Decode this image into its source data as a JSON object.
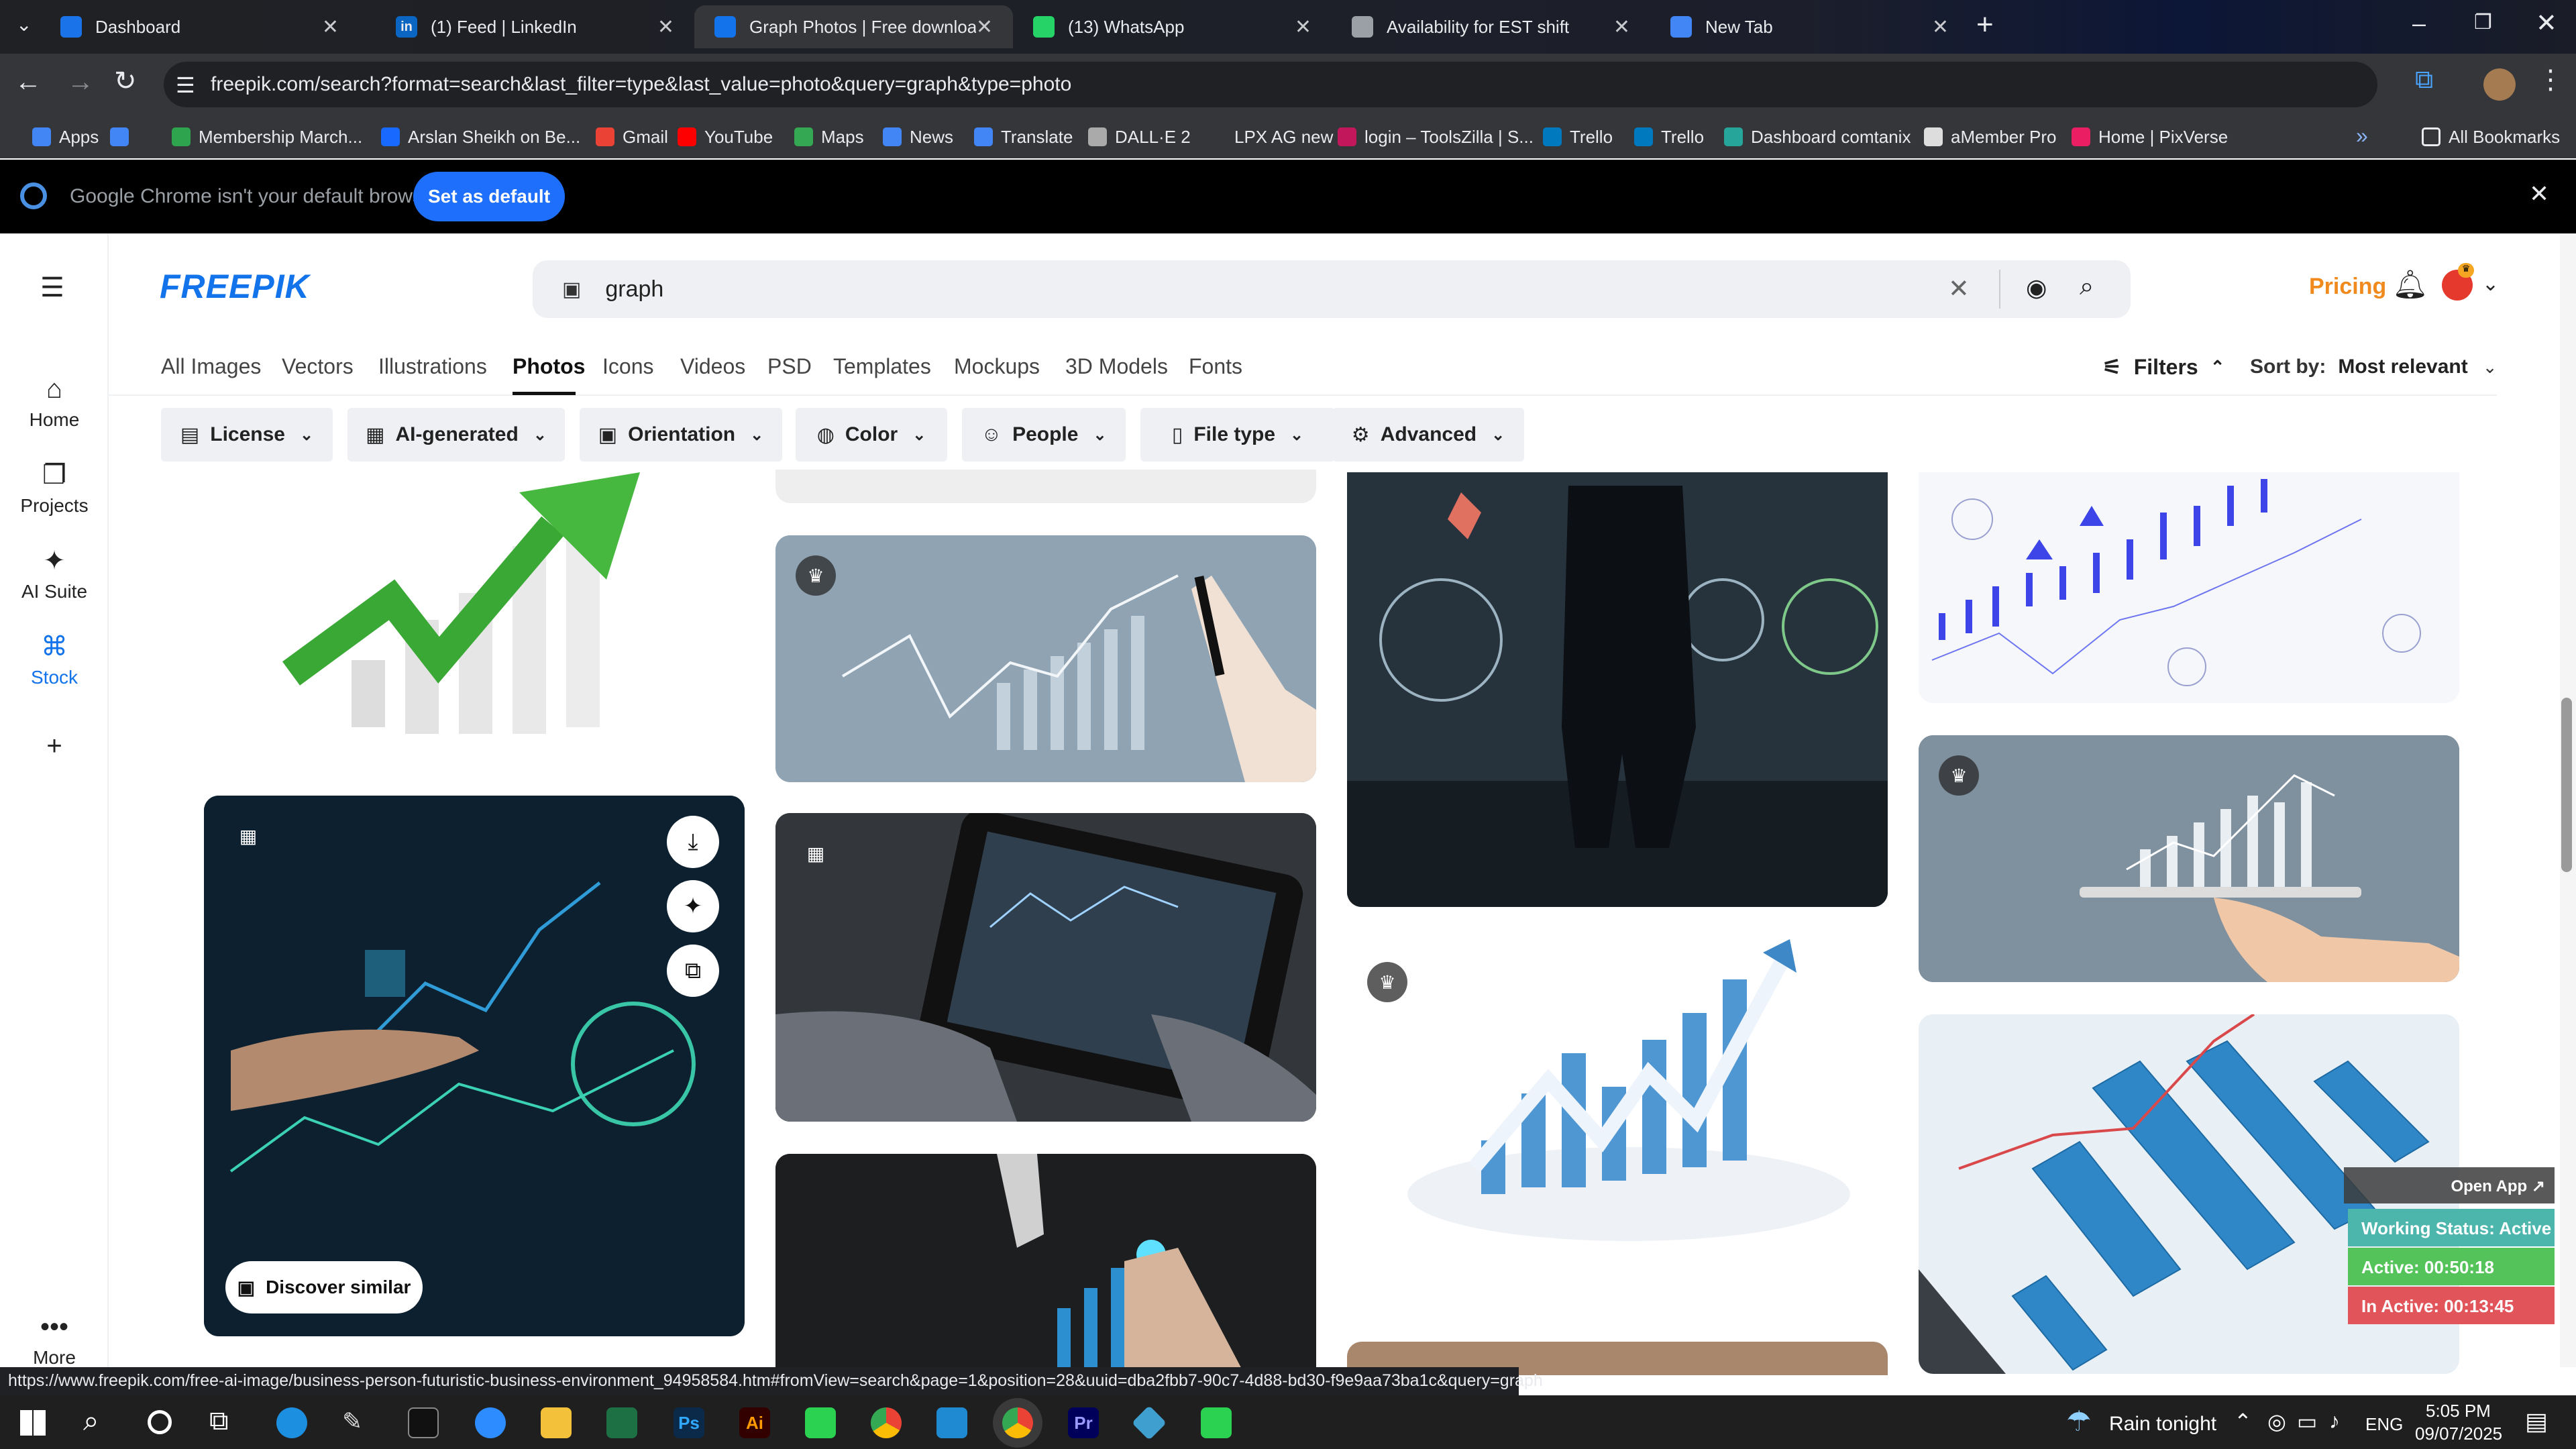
{
  "browser": {
    "tabs": [
      {
        "title": "Dashboard",
        "fav_color": "#1a73e8"
      },
      {
        "title": "(1) Feed | LinkedIn",
        "fav_color": "#0a66c2",
        "fav_text": "in"
      },
      {
        "title": "Graph Photos | Free download",
        "fav_color": "#1273eb",
        "active": true
      },
      {
        "title": "(13) WhatsApp",
        "fav_color": "#25d366"
      },
      {
        "title": "Availability for EST shift",
        "fav_color": "#9aa0a6"
      },
      {
        "title": "New Tab",
        "fav_color": "#4285f4"
      }
    ],
    "url": "freepik.com/search?format=search&last_filter=type&last_value=photo&query=graph&type=photo",
    "bookmarks": [
      {
        "label": "Apps",
        "color": "#4285f4"
      },
      {
        "label": "",
        "color": "#4285f4"
      },
      {
        "label": "Membership March...",
        "color": "#2ea44f"
      },
      {
        "label": "Arslan Sheikh on Be...",
        "color": "#1769ff"
      },
      {
        "label": "Gmail",
        "color": "#ea4335"
      },
      {
        "label": "YouTube",
        "color": "#ff0000"
      },
      {
        "label": "Maps",
        "color": "#34a853"
      },
      {
        "label": "News",
        "color": "#4285f4"
      },
      {
        "label": "Translate",
        "color": "#4285f4"
      },
      {
        "label": "DALL·E 2",
        "color": "#aaaaaa"
      },
      {
        "label": "LPX AG new",
        "color": "#35363a"
      },
      {
        "label": "login – ToolsZilla | S...",
        "color": "#c2185b"
      },
      {
        "label": "Trello",
        "color": "#0079bf"
      },
      {
        "label": "Trello",
        "color": "#0079bf"
      },
      {
        "label": "Dashboard comtanix",
        "color": "#26a69a"
      },
      {
        "label": "aMember Pro",
        "color": "#dddddd"
      },
      {
        "label": "Home | PixVerse",
        "color": "#e91e63"
      }
    ],
    "all_bookmarks": "All Bookmarks",
    "notice": "Google Chrome isn't your default browser",
    "set_default": "Set as default",
    "status_url": "https://www.freepik.com/free-ai-image/business-person-futuristic-business-environment_94958584.htm#fromView=search&page=1&position=28&uuid=dba2fbb7-90c7-4d88-bd30-f9e9aa73ba1c&query=graph"
  },
  "freepik": {
    "logo": "FREEPIK",
    "search_query": "graph",
    "pricing": "Pricing",
    "sidebar": [
      {
        "label": "Home",
        "icon": "home-icon",
        "glyph": "⌂"
      },
      {
        "label": "Projects",
        "icon": "folders-icon",
        "glyph": "❐"
      },
      {
        "label": "AI Suite",
        "icon": "sparkles-icon",
        "glyph": "✦"
      },
      {
        "label": "Stock",
        "icon": "stock-icon",
        "glyph": "⌘"
      },
      {
        "label": "",
        "icon": "plus-icon",
        "glyph": "+"
      },
      {
        "label": "More",
        "icon": "more-icon",
        "glyph": "•••"
      }
    ],
    "categories": [
      "All Images",
      "Vectors",
      "Illustrations",
      "Photos",
      "Icons",
      "Videos",
      "PSD",
      "Templates",
      "Mockups",
      "3D Models",
      "Fonts"
    ],
    "active_category": "Photos",
    "filters_label": "Filters",
    "sort_label": "Sort by:",
    "sort_value": "Most relevant",
    "filter_buttons": [
      "License",
      "AI-generated",
      "Orientation",
      "Color",
      "People",
      "File type",
      "Advanced"
    ],
    "discover_similar": "Discover similar"
  },
  "extension": {
    "open_app": "Open App ↗",
    "working_status": "Working Status: Active",
    "active": "Active: 00:50:18",
    "inactive": "In Active: 00:13:45"
  },
  "taskbar": {
    "weather": "Rain tonight",
    "lang": "ENG",
    "time": "5:05 PM",
    "date": "09/07/2025"
  }
}
